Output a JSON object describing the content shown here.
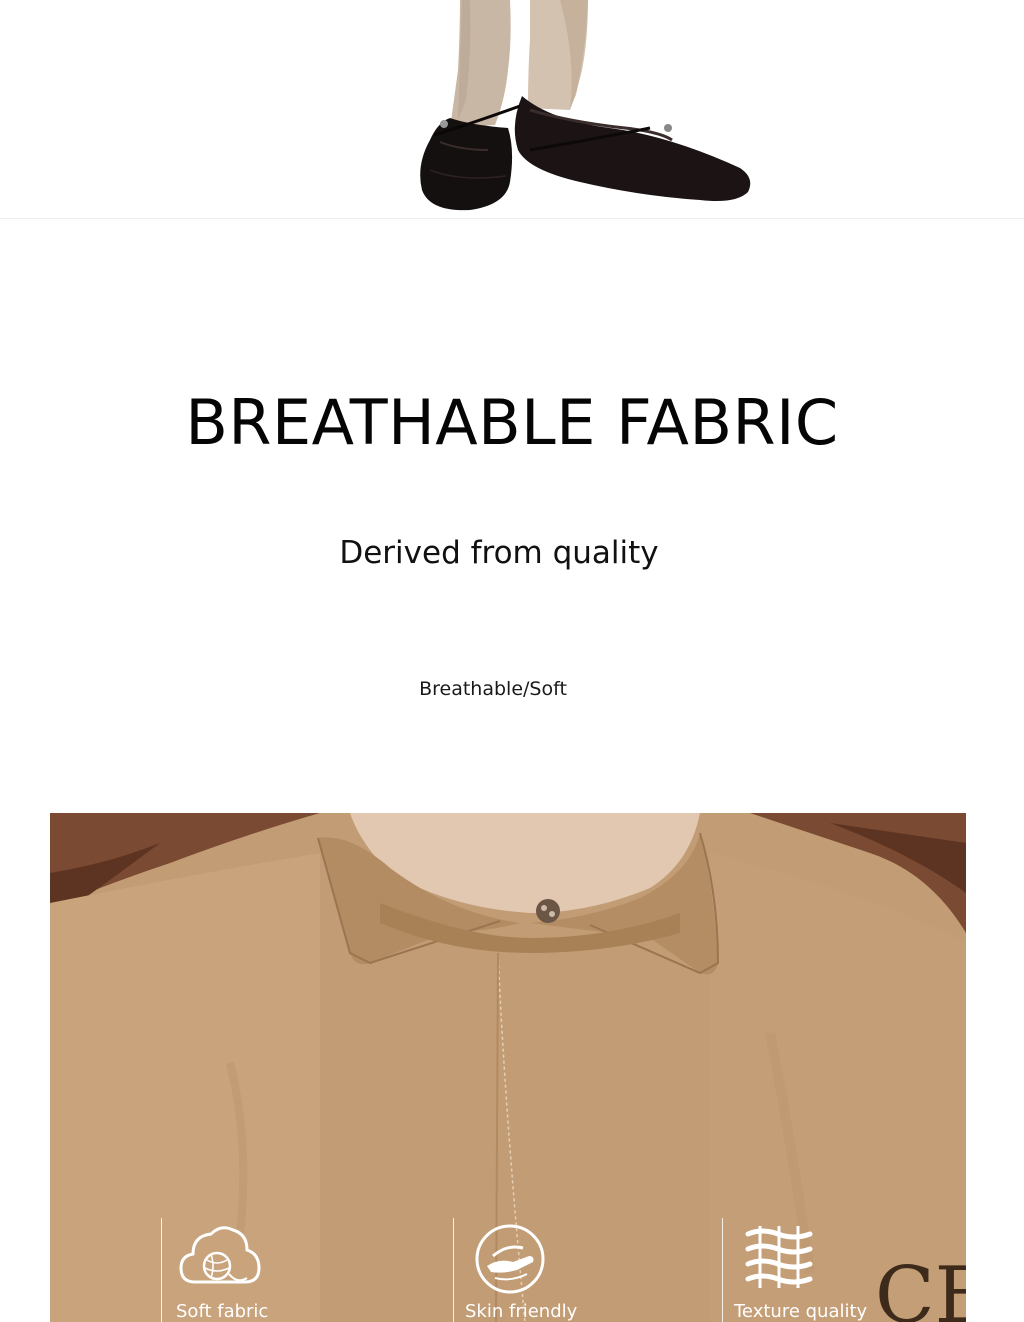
{
  "hero": {
    "title": "BREATHABLE FABRIC",
    "subtitle": "Derived from quality",
    "tagline": "Breathable/Soft"
  },
  "features": [
    {
      "label": "Soft fabric",
      "icon": "yarn-cloud-icon"
    },
    {
      "label": "Skin friendly",
      "icon": "hand-care-icon"
    },
    {
      "label": "Texture quality",
      "icon": "woven-texture-icon"
    }
  ],
  "colors": {
    "shirt": "#c29c74",
    "text": "#050505"
  }
}
